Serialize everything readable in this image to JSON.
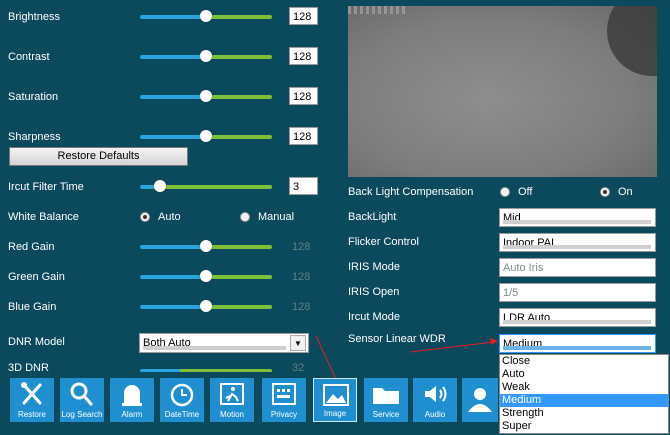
{
  "image_settings": {
    "brightness": {
      "label": "Brightness",
      "value": "128",
      "level": 0.5
    },
    "contrast": {
      "label": "Contrast",
      "value": "128",
      "level": 0.5
    },
    "saturation": {
      "label": "Saturation",
      "value": "128",
      "level": 0.5
    },
    "sharpness": {
      "label": "Sharpness",
      "value": "128",
      "level": 0.5
    },
    "restore_defaults": "Restore Defaults",
    "ircut_filter_time": {
      "label": "Ircut Filter Time",
      "value": "3",
      "level": 0.15
    },
    "white_balance": {
      "label": "White Balance",
      "auto": "Auto",
      "manual": "Manual",
      "selected": "Auto"
    },
    "red_gain": {
      "label": "Red Gain",
      "value": "128",
      "level": 0.5
    },
    "green_gain": {
      "label": "Green Gain",
      "value": "128",
      "level": 0.5
    },
    "blue_gain": {
      "label": "Blue Gain",
      "value": "128",
      "level": 0.5
    },
    "dnr_model": {
      "label": "DNR Model",
      "value": "Both Auto"
    },
    "dnr_3d": {
      "label": "3D DNR",
      "value": "32"
    }
  },
  "camera_settings": {
    "back_light_compensation": {
      "label": "Back Light Compensation",
      "off": "Off",
      "on": "On",
      "selected": "On"
    },
    "backlight": {
      "label": "BackLight",
      "value": "Mid"
    },
    "flicker_control": {
      "label": "Flicker Control",
      "value": "Indoor PAL"
    },
    "iris_mode": {
      "label": "IRIS Mode",
      "value": "Auto Iris"
    },
    "iris_open": {
      "label": "IRIS Open",
      "value": "1/5"
    },
    "ircut_mode": {
      "label": "Ircut Mode",
      "value": "LDR Auto"
    },
    "sensor_linear_wdr": {
      "label": "Sensor Linear WDR",
      "value": "Medium",
      "options": [
        "Close",
        "Auto",
        "Weak",
        "Medium",
        "Strength",
        "Super"
      ]
    }
  },
  "toolbar": [
    {
      "label": "Restore",
      "icon": "tools-icon"
    },
    {
      "label": "Log Search",
      "icon": "search-icon"
    },
    {
      "label": "Alarm",
      "icon": "alarm-icon"
    },
    {
      "label": "DateTime",
      "icon": "clock-icon"
    },
    {
      "label": "Motion",
      "icon": "motion-icon"
    },
    {
      "label": "Privacy",
      "icon": "privacy-icon"
    },
    {
      "label": "Image",
      "icon": "image-icon"
    },
    {
      "label": "Service",
      "icon": "folder-icon"
    },
    {
      "label": "Audio",
      "icon": "speaker-icon"
    },
    {
      "label": "",
      "icon": "user-icon"
    }
  ],
  "colors": {
    "background": "#0b4a5c",
    "accent": "#1f8fd0",
    "slider_left": "#2aa3de",
    "slider_right": "#7ec03a",
    "highlight": "#3399ff"
  }
}
